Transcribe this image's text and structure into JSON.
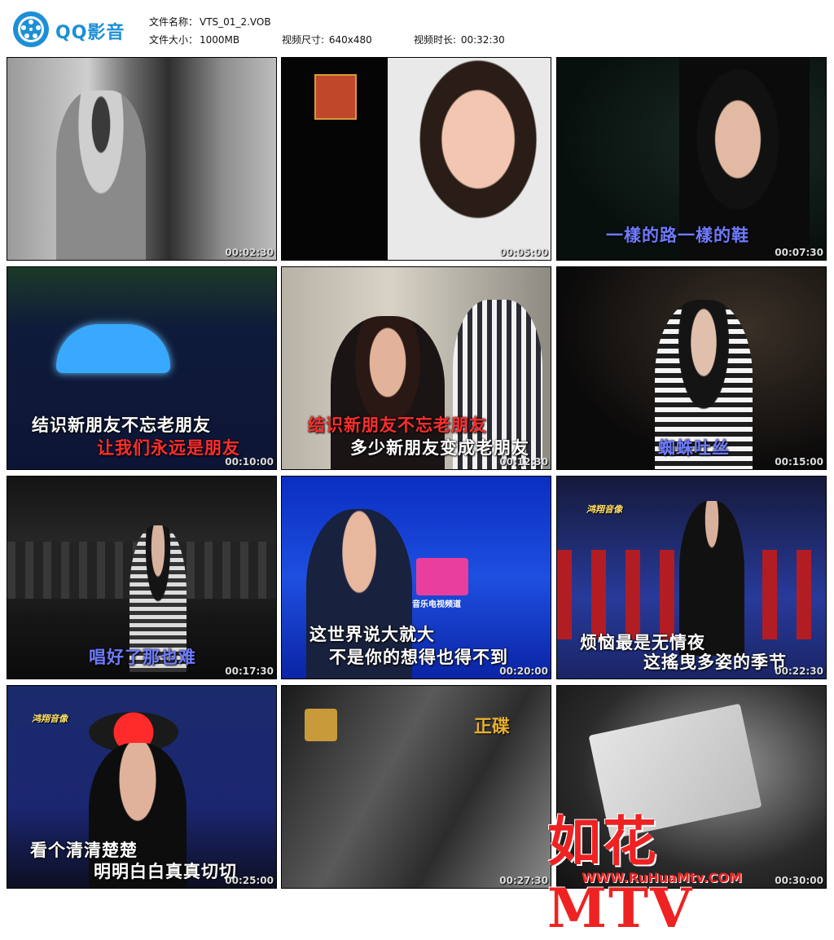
{
  "app": {
    "logo_text": "QQ影音"
  },
  "file_info": {
    "name_label": "文件名称：",
    "name_value": "VTS_01_2.VOB",
    "size_label": "文件大小：",
    "size_value": "1000MB",
    "dim_label": "视频尺寸: ",
    "dim_value": "640x480",
    "duration_label": "视频时长: ",
    "duration_value": "00:32:30"
  },
  "thumbnails": [
    {
      "time": "00:02:30",
      "lines": []
    },
    {
      "time": "00:05:00",
      "lines": []
    },
    {
      "time": "00:07:30",
      "lines": [
        "一樣的路一樣的鞋"
      ]
    },
    {
      "time": "00:10:00",
      "lines": [
        "结识新朋友不忘老朋友",
        "让我们永远是朋友"
      ]
    },
    {
      "time": "00:12:30",
      "lines": [
        "结识新朋友不忘老朋友",
        "多少新朋友变成老朋友"
      ]
    },
    {
      "time": "00:15:00",
      "lines": [
        "蜘蛛吐丝"
      ]
    },
    {
      "time": "00:17:30",
      "lines": [
        "唱好了那也难"
      ]
    },
    {
      "time": "00:20:00",
      "lines": [
        "这世界说大就大",
        "不是你的想得也得不到"
      ]
    },
    {
      "time": "00:22:30",
      "lines": [
        "烦恼最是无情夜",
        "这搖曳多姿的季节"
      ]
    },
    {
      "time": "00:25:00",
      "lines": [
        "看个清清楚楚",
        "明明白白真真切切"
      ]
    },
    {
      "time": "00:27:30",
      "lines": []
    },
    {
      "time": "00:30:00",
      "lines": []
    }
  ],
  "overlays": {
    "caption_hx": "鸿翔音像",
    "zhengdie": "正碟",
    "mtv_sub": "音乐电视频道",
    "watermark_text": "如花MTV",
    "watermark_url": "WWW.RuHuaMtv.COM"
  },
  "colors": {
    "brand": "#1d8fd6",
    "watermark": "#e22222"
  }
}
